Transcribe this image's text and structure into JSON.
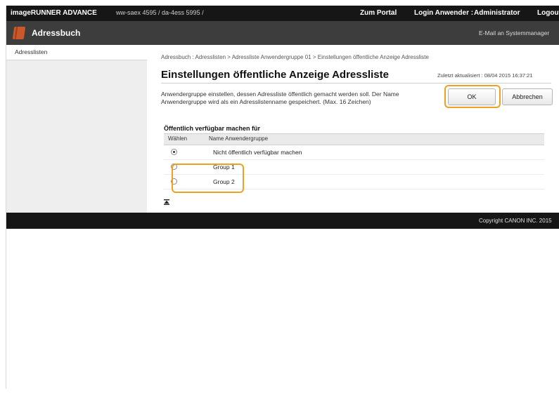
{
  "topbar": {
    "product": "imageRUNNER ADVANCE",
    "address": "ww-saex 4595 / da-4ess 5995 /",
    "portal": "Zum Portal",
    "login_label": "Login Anwender :",
    "login_user": "Administrator",
    "logout": "Logout"
  },
  "header": {
    "title": "Adressbuch",
    "mail_admin": "E-Mail an Systemmanager"
  },
  "sidebar": {
    "items": [
      {
        "label": "Adresslisten"
      }
    ]
  },
  "main": {
    "breadcrumb": "Adressbuch : Adresslisten > Adressliste Anwendergruppe 01 > Einstellungen öffentliche Anzeige Adressliste",
    "title": "Einstellungen öffentliche Anzeige Adressliste",
    "updated": "Zuletzt aktualisiert : 08/04 2015 16:37:21",
    "description": "Anwendergruppe einstellen, dessen Adressliste öffentlich gemacht werden soll. Der Name Anwendergruppe wird als ein Adresslistenname gespeichert. (Max. 16 Zeichen)",
    "ok_label": "OK",
    "cancel_label": "Abbrechen",
    "section_title": "Öffentlich verfügbar machen für",
    "table": {
      "headers": [
        "Wählen",
        "Name Anwendergruppe"
      ],
      "rows": [
        {
          "name": "Nicht öffentlich verfügbar machen",
          "selected": true
        },
        {
          "name": "Group 1",
          "selected": false
        },
        {
          "name": "Group 2",
          "selected": false
        }
      ]
    }
  },
  "footer": {
    "copyright": "Copyright CANON INC. 2015"
  },
  "colors": {
    "highlight": "#f0a020",
    "topbar": "#161616",
    "header": "#3d3d3d",
    "book_icon": "#c9582a"
  }
}
